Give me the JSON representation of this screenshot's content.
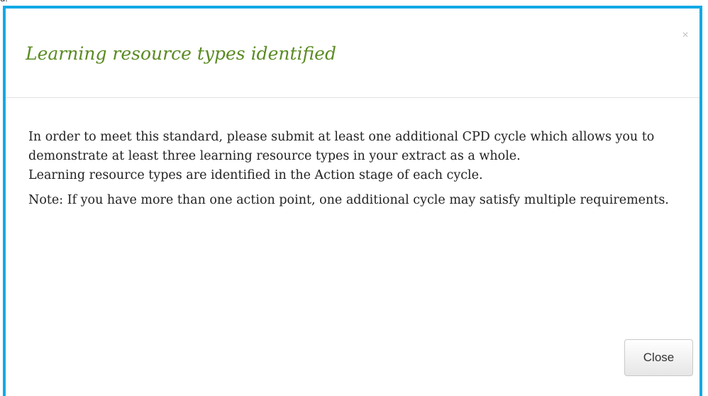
{
  "background_fragment": "d.",
  "dialog": {
    "title": "Learning resource types identified",
    "close_icon_glyph": "×",
    "body": {
      "paragraph_1_line_1": "In order to meet this standard, please submit at least one additional CPD cycle which allows you to demonstrate at least three learning resource types in your extract as a whole.",
      "paragraph_1_line_2": "Learning resource types are identified in the Action stage of each cycle.",
      "paragraph_2": "Note: If you have more than one action point, one additional cycle may satisfy multiple requirements."
    },
    "footer": {
      "close_label": "Close"
    }
  },
  "colors": {
    "border_accent": "#12a9e5",
    "title": "#5a8a22",
    "body_text": "#222222"
  },
  "icons": {
    "dialog_close": "close-icon"
  }
}
